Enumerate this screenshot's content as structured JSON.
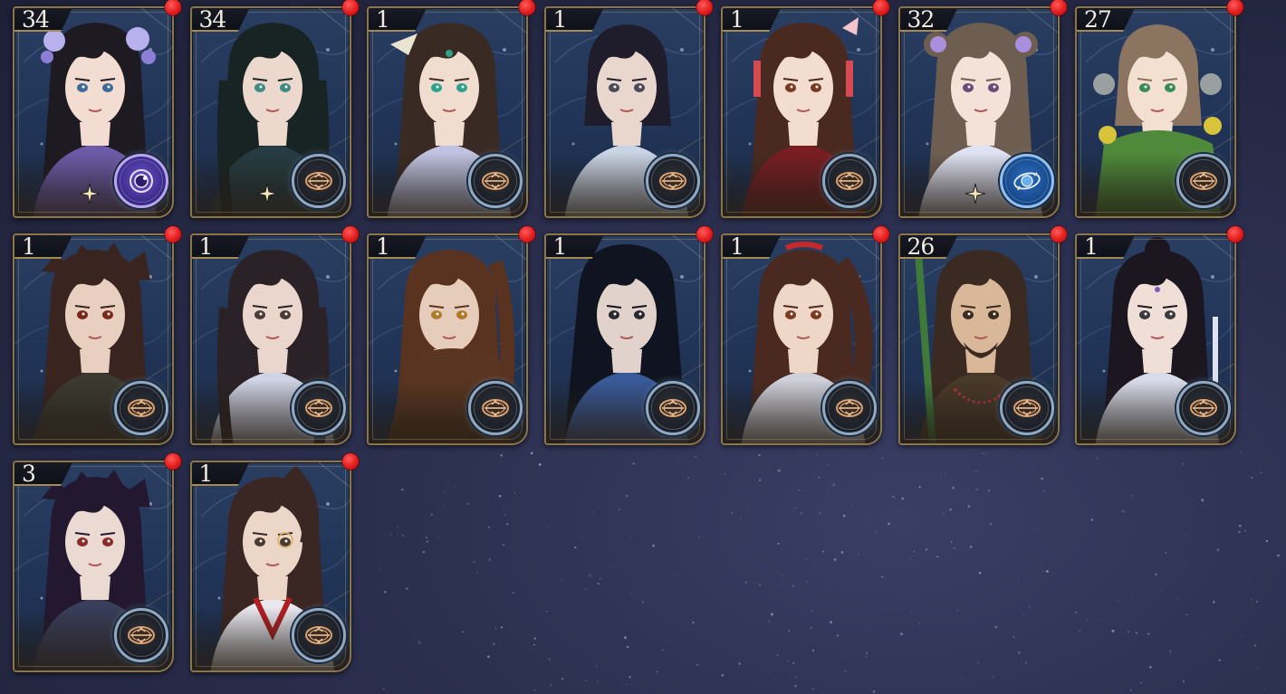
{
  "colors": {
    "background": "#262a45",
    "card_frame": "#8c7649",
    "notification": "#e31c1c",
    "count_text": "#f2ede3"
  },
  "cards": [
    {
      "count": "34",
      "hair": "#1e1a22",
      "skin": "#f3ddd2",
      "outfit": "#6d5aa8",
      "hair_style": "female-flowers",
      "accent": "#b9b1ee",
      "emblem": "purple",
      "sparkle": true,
      "eye": "#3e6c9a"
    },
    {
      "count": "34",
      "hair": "#182424",
      "skin": "#ecd8cc",
      "outfit": "#263c42",
      "hair_style": "male-long",
      "accent": "#c6a867",
      "emblem": "default",
      "sparkle": true,
      "eye": "#3e8a84"
    },
    {
      "count": "1",
      "hair": "#3a2a24",
      "skin": "#f1dcd0",
      "outfit": "#bfc2e0",
      "hair_style": "female-long",
      "accent": "#e8e6d8",
      "emblem": "default",
      "sparkle": false,
      "eye": "#2fa08a"
    },
    {
      "count": "1",
      "hair": "#1f1d2c",
      "skin": "#e9d6cc",
      "outfit": "#c9d4e4",
      "hair_style": "male-short",
      "accent": "#2a2a36",
      "emblem": "default",
      "sparkle": false,
      "eye": "#4c4a58"
    },
    {
      "count": "1",
      "hair": "#4a2a20",
      "skin": "#f3ddd0",
      "outfit": "#7a1e22",
      "hair_style": "female-ribbon",
      "accent": "#d64a52",
      "emblem": "default",
      "sparkle": false,
      "eye": "#7a3a20"
    },
    {
      "count": "32",
      "hair": "#6e5e52",
      "skin": "#f4e2d8",
      "outfit": "#dfe2f2",
      "hair_style": "female-buns",
      "accent": "#a990de",
      "emblem": "blue",
      "sparkle": true,
      "eye": "#6a4a7a"
    },
    {
      "count": "27",
      "hair": "#8b7460",
      "skin": "#f4e0d0",
      "outfit": "#4f8a3a",
      "hair_style": "child",
      "accent": "#d8c43a",
      "emblem": "default",
      "sparkle": false,
      "eye": "#3a8a5a"
    },
    {
      "count": "1",
      "hair": "#3a2420",
      "skin": "#e8cfc0",
      "outfit": "#3c3a30",
      "hair_style": "male-messy",
      "accent": "#c05a2a",
      "emblem": "default",
      "sparkle": false,
      "eye": "#7a2a1a"
    },
    {
      "count": "1",
      "hair": "#2a2226",
      "skin": "#ead6cc",
      "outfit": "#cfd3e4",
      "hair_style": "male-long",
      "accent": "#2a2a2a",
      "emblem": "default",
      "sparkle": false,
      "eye": "#4a3a3a"
    },
    {
      "count": "1",
      "hair": "#5a3220",
      "skin": "#e6ccba",
      "outfit": "#5a3622",
      "hair_style": "male-mask",
      "accent": "#d69a3a",
      "emblem": "default",
      "sparkle": false,
      "eye": "#b07a2a"
    },
    {
      "count": "1",
      "hair": "#101420",
      "skin": "#e2d2cc",
      "outfit": "#3a5a9a",
      "hair_style": "male-straight",
      "accent": "#6a8ad0",
      "emblem": "default",
      "sparkle": false,
      "eye": "#2a2a30"
    },
    {
      "count": "1",
      "hair": "#4a2a20",
      "skin": "#efd7c8",
      "outfit": "#d0d0da",
      "hair_style": "female-ponytail",
      "accent": "#c42a2a",
      "emblem": "default",
      "sparkle": false,
      "eye": "#7a3a20"
    },
    {
      "count": "26",
      "hair": "#3a2a22",
      "skin": "#d9b89a",
      "outfit": "#4a3a2a",
      "hair_style": "male-beard",
      "accent": "#c03a3a",
      "emblem": "default",
      "sparkle": false,
      "eye": "#3a2a20"
    },
    {
      "count": "1",
      "hair": "#1c1620",
      "skin": "#efdfd6",
      "outfit": "#d8dcea",
      "hair_style": "male-bun",
      "accent": "#7a5ac0",
      "emblem": "default",
      "sparkle": false,
      "eye": "#3a3a40"
    },
    {
      "count": "3",
      "hair": "#231830",
      "skin": "#eadad2",
      "outfit": "#3a3e5a",
      "hair_style": "male-messy",
      "accent": "#6a4a8a",
      "emblem": "default",
      "sparkle": false,
      "eye": "#8a2a2a"
    },
    {
      "count": "1",
      "hair": "#3a2622",
      "skin": "#ecd6c8",
      "outfit": "#e8e8ee",
      "hair_style": "male-glasses",
      "accent": "#b21e22",
      "emblem": "default",
      "sparkle": false,
      "eye": "#4a3a30"
    }
  ]
}
